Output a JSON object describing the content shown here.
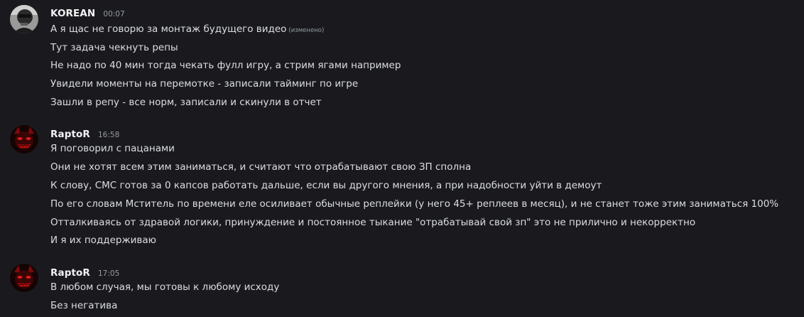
{
  "messages": [
    {
      "author": "KOREAN",
      "time": "00:07",
      "avatar_icon": "bw-portrait-avatar",
      "lines": [
        "А я щас не говорю за монтаж будущего видео",
        "Тут задача чекнуть репы",
        "Не надо по 40 мин тогда чекать фулл игру, а стрим ягами например",
        "Увидели моменты на перемотке - записали тайминг по игре",
        "Зашли в репу - все норм, записали и скинули в отчет"
      ],
      "edited_label": "(изменено)"
    },
    {
      "author": "RaptoR",
      "time": "16:58",
      "avatar_icon": "red-demon-avatar",
      "lines": [
        "Я поговорил с пацанами",
        "Они не хотят всем этим заниматься, и считают что отрабатывают свою ЗП сполна",
        "К слову, СМС готов за 0 капсов работать дальше, если вы другого мнения, а при надобности уйти в демоут",
        "По его словам Мститель по времени еле осиливает обычные реплейки (у него 45+ реплеев в месяц), и не станет тоже этим заниматься 100%",
        "Отталкиваясь от здравой логики, принуждение и постоянное тыкание \"отрабатывай свой зп\" это не прилично и некорректно",
        "И я их поддерживаю"
      ]
    },
    {
      "author": "RaptoR",
      "time": "17:05",
      "avatar_icon": "red-demon-avatar",
      "lines": [
        "В любом случая, мы готовы к любому исходу",
        "Без негатива"
      ]
    }
  ]
}
